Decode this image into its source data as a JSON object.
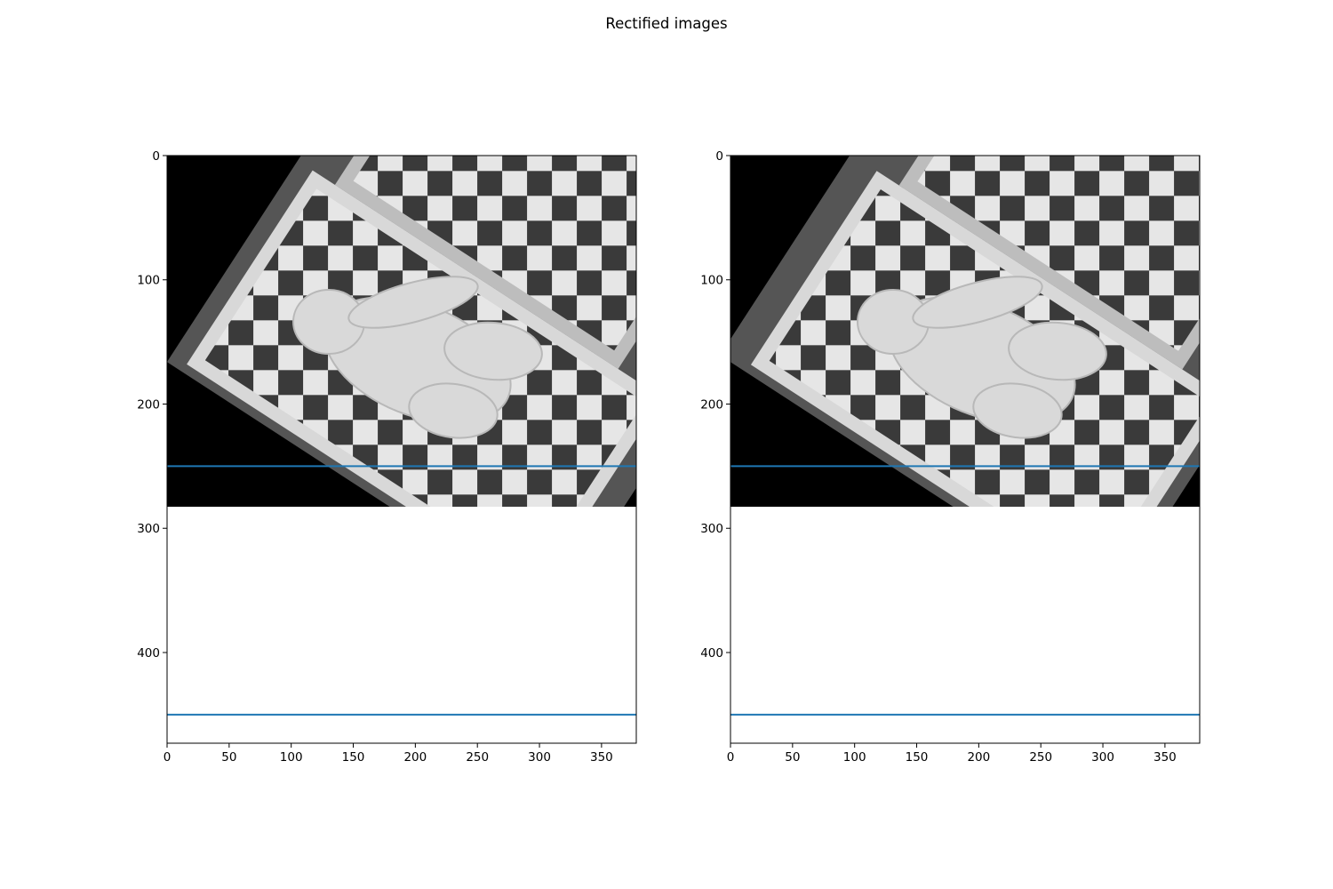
{
  "figure": {
    "title": "Rectified images"
  },
  "colors": {
    "line": "#1f77b4",
    "tick": "#000000",
    "background": "#ffffff",
    "image_fill": "#000000"
  },
  "image_content": {
    "description_icon": "grayscale-photo-rabbit-plush-on-checkerboard",
    "rotation_deg": 33,
    "image_height_rows": 283
  },
  "subplots": [
    {
      "id": "left",
      "xlim": [
        0,
        378
      ],
      "ylim": [
        473,
        0
      ],
      "xticks": [
        0,
        50,
        100,
        150,
        200,
        250,
        300,
        350
      ],
      "yticks": [
        0,
        100,
        200,
        300,
        400
      ],
      "hlines": [
        250,
        450
      ],
      "image_offset": 0
    },
    {
      "id": "right",
      "xlim": [
        0,
        378
      ],
      "ylim": [
        473,
        0
      ],
      "xticks": [
        0,
        50,
        100,
        150,
        200,
        250,
        300,
        350
      ],
      "yticks": [
        0,
        100,
        200,
        300,
        400
      ],
      "hlines": [
        250,
        450
      ],
      "image_offset": 12
    }
  ]
}
